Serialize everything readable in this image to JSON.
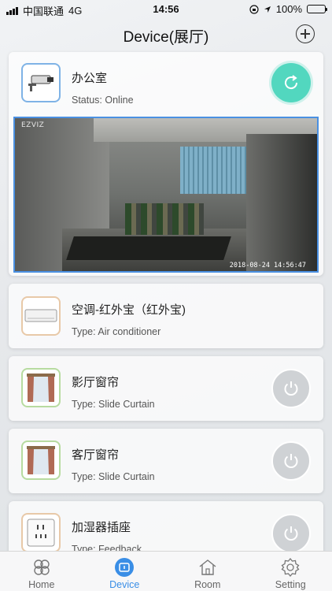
{
  "status_bar": {
    "carrier": "中国联通",
    "network": "4G",
    "time": "14:56",
    "battery": "100%"
  },
  "nav": {
    "title": "Device(展厅)",
    "add_icon": "plus-circle-icon"
  },
  "devices": [
    {
      "name": "办公室",
      "subtitle": "Status: Online",
      "thumb_icon": "security-camera-icon",
      "action_icon": "refresh-icon",
      "video": {
        "watermark": "EZVIZ",
        "timestamp": "2018-08-24 14:56:47"
      }
    },
    {
      "name": "空调-红外宝（红外宝)",
      "subtitle": "Type: Air conditioner",
      "thumb_icon": "air-conditioner-icon"
    },
    {
      "name": "影厅窗帘",
      "subtitle": "Type: Slide Curtain",
      "thumb_icon": "curtain-icon",
      "action_icon": "power-icon"
    },
    {
      "name": "客厅窗帘",
      "subtitle": "Type: Slide Curtain",
      "thumb_icon": "curtain-icon",
      "action_icon": "power-icon"
    },
    {
      "name": "加湿器插座",
      "subtitle": "Type: Feedback",
      "thumb_icon": "wall-socket-icon",
      "action_icon": "power-icon"
    }
  ],
  "tabs": [
    {
      "label": "Home",
      "icon": "home-clover-icon",
      "active": false
    },
    {
      "label": "Device",
      "icon": "device-icon",
      "active": true
    },
    {
      "label": "Room",
      "icon": "room-house-icon",
      "active": false
    },
    {
      "label": "Setting",
      "icon": "gear-icon",
      "active": false
    }
  ],
  "colors": {
    "accent": "#3a8ee6",
    "refresh_button": "#52d7bf",
    "power_button": "#cfd2d5",
    "video_border": "#4a90e2"
  }
}
